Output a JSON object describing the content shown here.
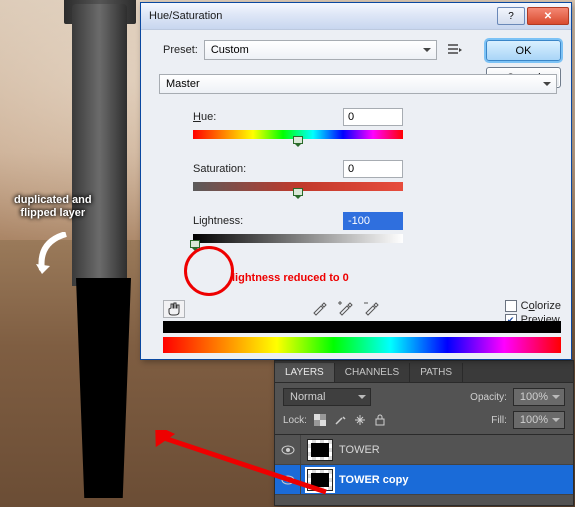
{
  "dialog": {
    "title": "Hue/Saturation",
    "preset_label": "Preset:",
    "preset_value": "Custom",
    "master_value": "Master",
    "ok_label": "OK",
    "cancel_label": "Cancel",
    "hue_label": "Hue:",
    "hue_value": "0",
    "saturation_label": "Saturation:",
    "saturation_value": "0",
    "lightness_label": "Lightness:",
    "lightness_value": "-100",
    "colorize_label": "Colorize",
    "preview_label": "Preview",
    "preview_checked": true,
    "colorize_checked": false
  },
  "annotation": {
    "flipped": "duplicated and\nflipped layer",
    "lightness_note": "lightness reduced to 0"
  },
  "layers_panel": {
    "tabs": [
      "LAYERS",
      "CHANNELS",
      "PATHS"
    ],
    "mode_value": "Normal",
    "opacity_label": "Opacity:",
    "opacity_value": "100%",
    "lock_label": "Lock:",
    "fill_label": "Fill:",
    "fill_value": "100%",
    "layers": [
      {
        "name": "TOWER",
        "visible": true,
        "active": false
      },
      {
        "name": "TOWER copy",
        "visible": true,
        "active": true
      }
    ]
  }
}
